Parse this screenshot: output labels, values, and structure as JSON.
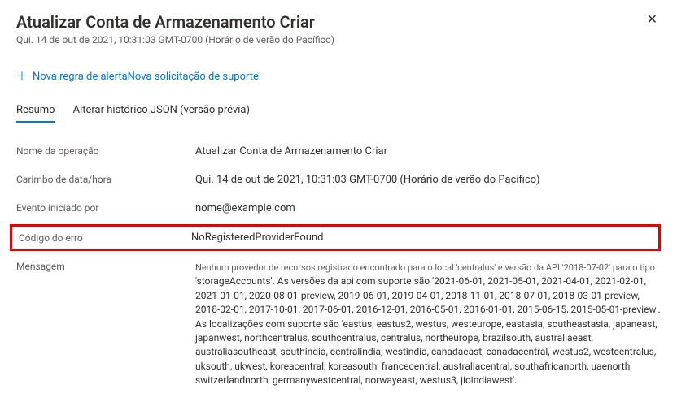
{
  "header": {
    "title": "Atualizar Conta de Armazenamento Criar",
    "subtitle": "Qui. 14 de out de 2021, 10:31:03 GMT-0700 (Horário de verão do Pacífico)"
  },
  "toolbar": {
    "new_alert_rule": "Nova regra de alerta",
    "new_support_request": "Nova solicitação de suporte"
  },
  "tabs": {
    "summary": "Resumo",
    "json_history": "Alterar histórico JSON (versão prévia)"
  },
  "details": {
    "operation_name_label": "Nome da operação",
    "operation_name_value": "Atualizar Conta de Armazenamento Criar",
    "timestamp_label": "Carimbo de data/hora",
    "timestamp_value": "Qui. 14 de out de 2021, 10:31:03 GMT-0700 (Horário de verão do Pacífico)",
    "initiated_by_label": "Evento iniciado por",
    "initiated_by_value": "nome@example.com",
    "error_code_label": "Código do erro",
    "error_code_value": "NoRegisteredProviderFound",
    "message_label": "Mensagem",
    "message_prefix": "Nenhum provedor de recursos registrado encontrado para o local 'centralus' e versão da API '2018-07-02' para o tipo",
    "message_body": "'storageAccounts'. As versões da api com suporte são '2021-06-01, 2021-05-01, 2021-04-01, 2021-02-01, 2021-01-01, 2020-08-01-preview, 2019-06-01, 2019-04-01, 2018-11-01, 2018-07-01, 2018-03-01-preview, 2018-02-01, 2017-10-01, 2017-06-01, 2016-12-01, 2016-05-01, 2016-01-01, 2015-06-15, 2015-05-01-preview'. As localizações com suporte são 'eastus, eastus2, westus, westeurope, eastasia, southeastasia, japaneast, japanwest, northcentralus, southcentralus, centralus, northeurope, brazilsouth, australiaeast, australiasoutheast, southindia, centralindia, westindia, canadaeast, canadacentral, westus2, westcentralus, uksouth, ukwest, koreacentral, koreasouth, francecentral, australiacentral, southafricanorth, uaenorth, switzerlandnorth, germanywestcentral, norwayeast, westus3, jioindiawest'."
  }
}
